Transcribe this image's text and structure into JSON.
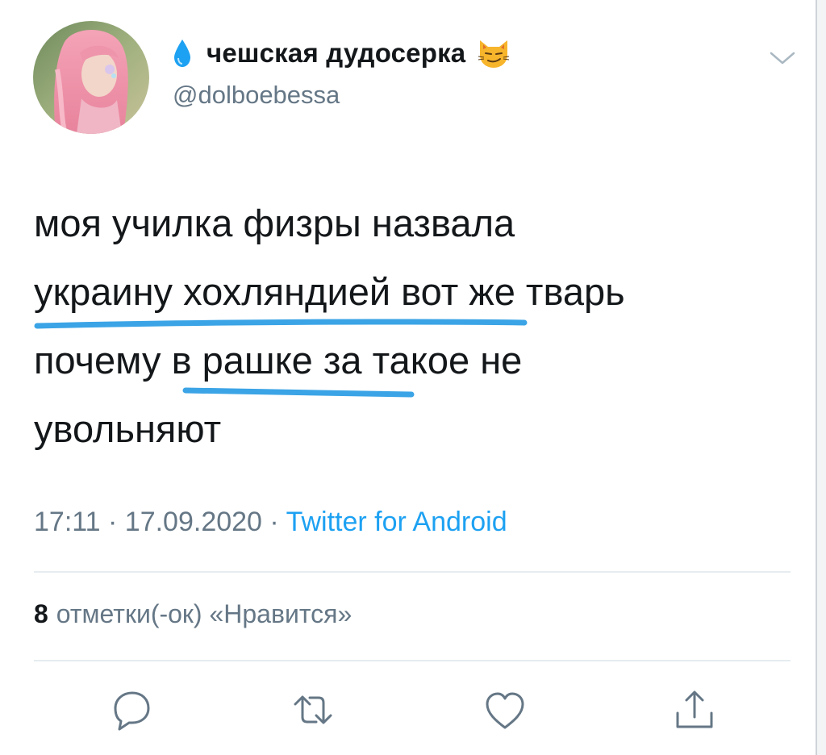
{
  "tweet": {
    "display_name": "чешская дудосерка",
    "handle": "@dolboebessa",
    "icons": {
      "name_prefix": "droplet-icon",
      "name_suffix": "smirking-cat-icon",
      "menu": "chevron-down-icon"
    },
    "text": "моя училка физры назвала\nукраину хохляндией вот же тварь\nпочему в рашке за такое не\nувольняют",
    "time": "17:11",
    "date": "17.09.2020",
    "separator": "·",
    "source": "Twitter for Android",
    "likes_count": "8",
    "likes_label": "отметки(-ок) «Нравится»"
  },
  "actions": [
    "reply-icon",
    "retweet-icon",
    "like-icon",
    "share-icon"
  ],
  "colors": {
    "text": "#14171a",
    "secondary": "#657786",
    "link": "#1da1f2",
    "divider": "#e6ecf0",
    "highlight_underline": "#3ba4e6",
    "droplet": "#1da1f2",
    "cat_emoji": "#f7b52c"
  }
}
